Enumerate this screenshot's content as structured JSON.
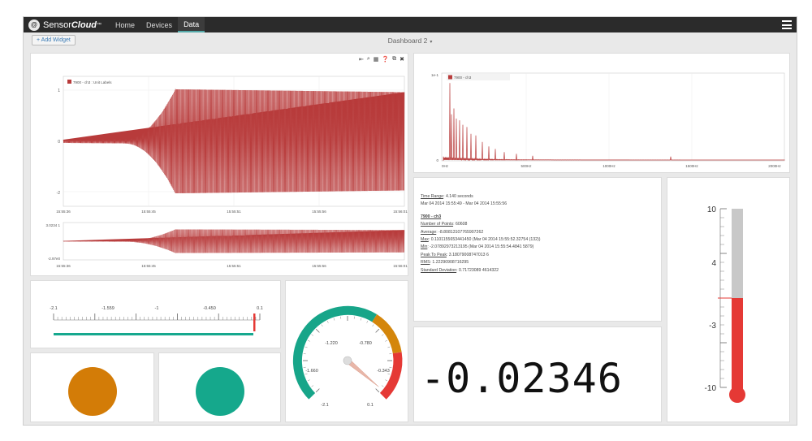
{
  "app": {
    "brand_sensor": "Sensor",
    "brand_cloud": "Cloud",
    "brand_tm": "™",
    "logo_glyph": "@"
  },
  "nav": {
    "items": [
      {
        "label": "Home",
        "active": false
      },
      {
        "label": "Devices",
        "active": false
      },
      {
        "label": "Data",
        "active": true
      }
    ]
  },
  "toolbar": {
    "add_widget_label": "+ Add Widget",
    "dashboard_title": "Dashboard 2",
    "dashboard_caret": "▾"
  },
  "icons": {
    "widget_tools": [
      "⇤",
      "⌕",
      "▦",
      "❓",
      "⧉",
      "✖"
    ],
    "menu": "hamburger-icon"
  },
  "timeseries": {
    "legend": "7900 - ch3 : Unit Labels",
    "color": "#b83b3b",
    "y_ticks": [
      "1",
      "0",
      "-2"
    ],
    "x_ticks": [
      "15:55:36",
      "15:55:45",
      "15:55:51",
      "15:55:56",
      "15:56:01"
    ],
    "nav_y_top": "3.0234 1",
    "nav_y_bottom": "-2.97e0",
    "nav_x_ticks": [
      "15:55:36",
      "15:55:45",
      "15:55:51",
      "15:55:56",
      "15:56:01"
    ]
  },
  "fft": {
    "legend": "7900 - ch3",
    "y_top": "1e-1",
    "y_bottom": "0",
    "x_ticks": [
      "0Hz",
      "500Hz",
      "1000Hz",
      "1500Hz",
      "2000Hz"
    ],
    "color": "#b83b3b"
  },
  "stats": {
    "time_range_label": "Time Range",
    "time_range_value": ": 4.140 seconds",
    "time_span": "Mar 04 2014 15:55:49 - Mar 04 2014 15:55:56",
    "channel_title": "7900 - ch3",
    "rows": [
      {
        "label": "Number of Points",
        "value": ": 60608"
      },
      {
        "label": "Average",
        "value": ": -8.80813107765907262"
      },
      {
        "label": "Max",
        "value": ": 0.1101155653441450 (Mar 04 2014 15:55:52.32754 (132))"
      },
      {
        "label": "Min",
        "value": ": -2.07892973213195 (Mar 04 2014 15:55:54.4841 5879)"
      },
      {
        "label": "Peak To Peak",
        "value": ": 3.18079008747013 6"
      },
      {
        "label": "RMS",
        "value": ": 1.22290908716295"
      },
      {
        "label": "Standard Deviation",
        "value": ": 0.71723089 4614322"
      }
    ]
  },
  "linear_gauge": {
    "ticks": [
      "-2.1",
      "-1.559",
      "-1",
      "-0.450",
      "0.1"
    ],
    "value": 0.1,
    "min": -2.1,
    "max": 0.1,
    "bar_color": "#16a88e",
    "marker_color": "#e53935"
  },
  "dial_gauge": {
    "labels": [
      "-1.220",
      "-0.780",
      "-1.660",
      "-0.343",
      "-2.1",
      "0.1"
    ],
    "min": -2.1,
    "max": 0.1,
    "value": 0.06,
    "colors": {
      "green": "#17a589",
      "orange": "#d4860b",
      "red": "#e53935"
    }
  },
  "indicators": [
    {
      "name": "status-light-orange",
      "color": "#d37c07"
    },
    {
      "name": "status-light-teal",
      "color": "#15a88c"
    }
  ],
  "readout": {
    "value": "-0.02346"
  },
  "thermometer": {
    "ticks": [
      "10",
      "4",
      "-3",
      "-10"
    ],
    "min": -10,
    "max": 10,
    "value": 0,
    "fill_color": "#e53935",
    "tube_color": "#c8c8c8"
  }
}
